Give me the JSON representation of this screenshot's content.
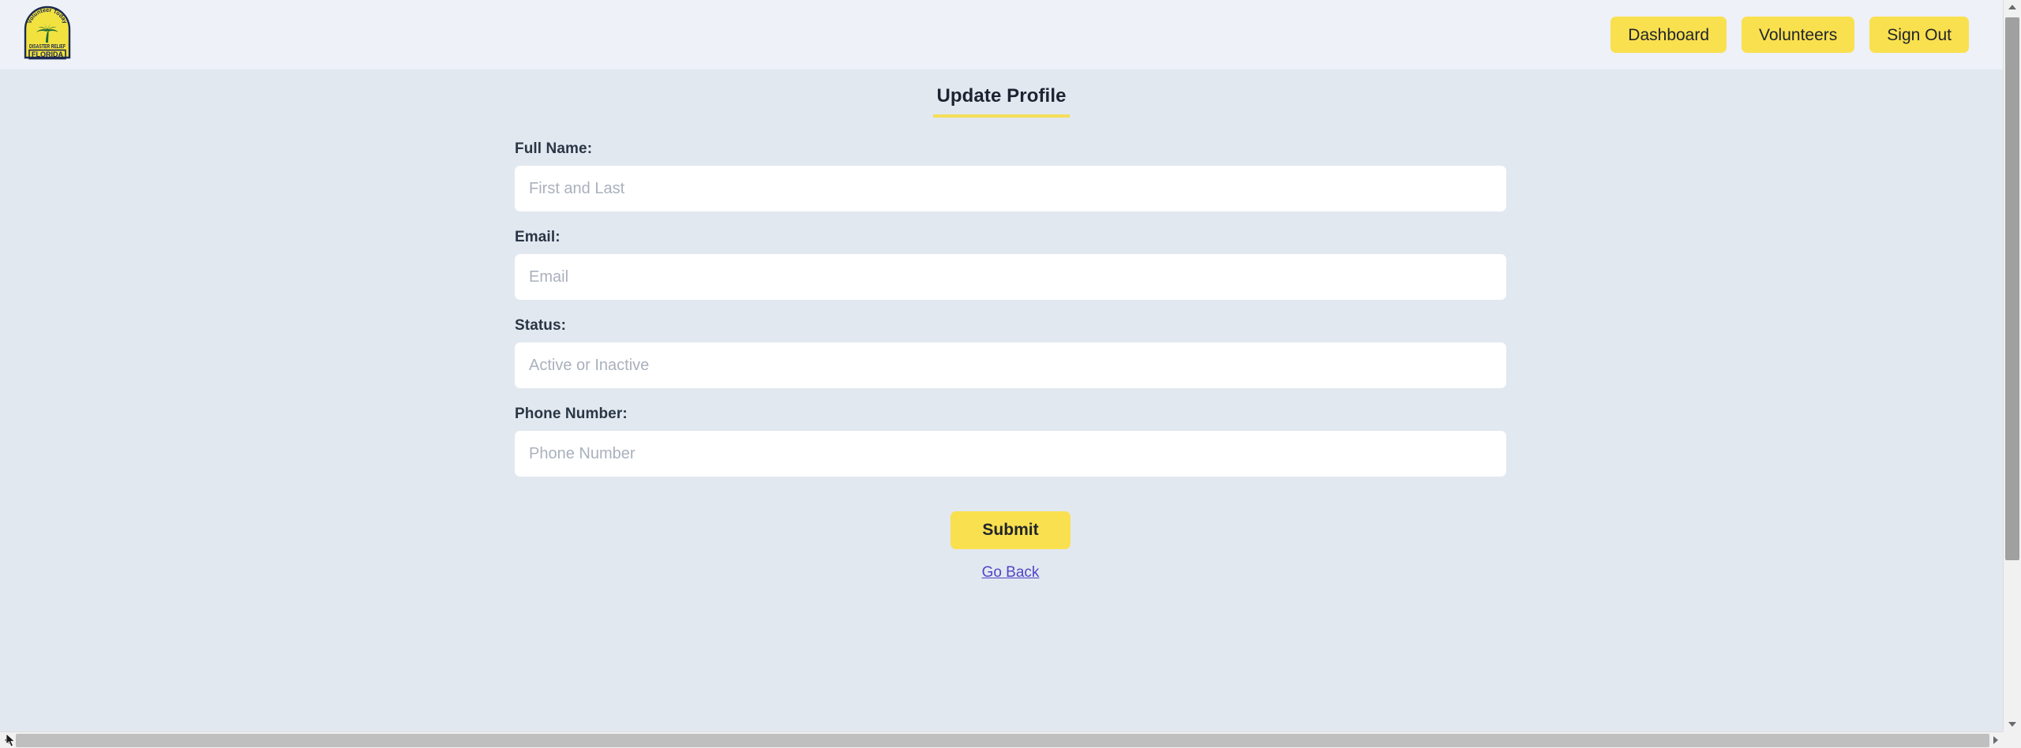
{
  "header": {
    "logo": {
      "icon": "disaster-relief-florida-badge-logo",
      "arc_text": "Volunteer Today",
      "middle_text": "DISASTER RELIEF",
      "bottom_text": "FLORIDA",
      "badge_color": "#f2e23f",
      "outline_color": "#1d2a52",
      "palm_color": "#1d6b35"
    },
    "nav": [
      {
        "label": "Dashboard",
        "name": "nav-dashboard-button"
      },
      {
        "label": "Volunteers",
        "name": "nav-volunteers-button"
      },
      {
        "label": "Sign Out",
        "name": "nav-sign-out-button"
      }
    ],
    "background": "#eef1f7",
    "button_color": "#f9e04f"
  },
  "main": {
    "title": "Update Profile",
    "title_underline_color": "#f5dd57",
    "background": "#e2e8f0",
    "fields": [
      {
        "label": "Full Name:",
        "placeholder": "First and Last",
        "value": "",
        "name": "full-name"
      },
      {
        "label": "Email:",
        "placeholder": "Email",
        "value": "",
        "name": "email"
      },
      {
        "label": "Status:",
        "placeholder": "Active or Inactive",
        "value": "",
        "name": "status"
      },
      {
        "label": "Phone Number:",
        "placeholder": "Phone Number",
        "value": "",
        "name": "phone-number"
      }
    ],
    "submit_label": "Submit",
    "go_back_label": "Go Back",
    "link_color": "#4f46c8"
  },
  "scrollbars": {
    "vertical_present": true,
    "horizontal_present": true,
    "thumb_color": "#a0a0a0",
    "track_color": "#f1f1f1"
  }
}
